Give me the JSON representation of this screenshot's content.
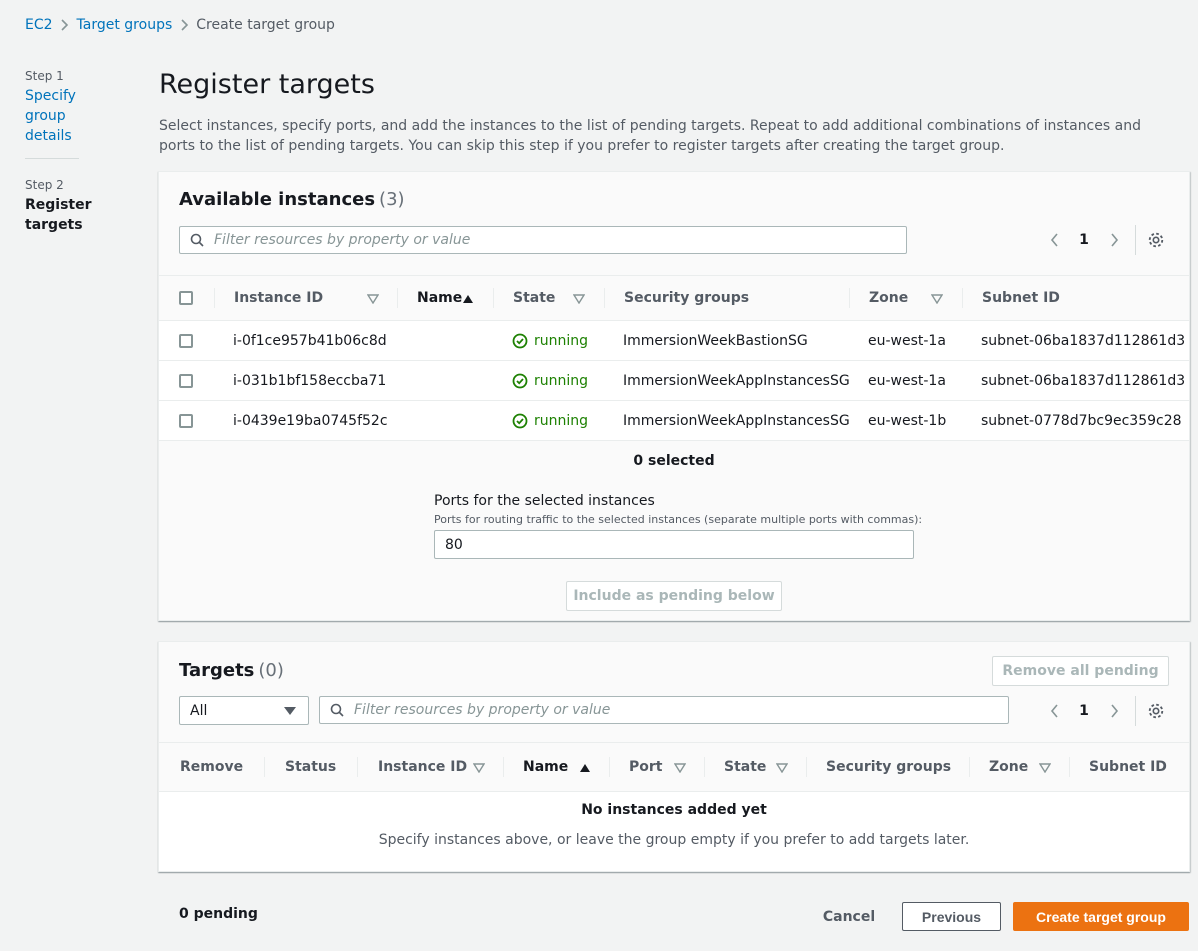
{
  "breadcrumb": {
    "items": [
      "EC2",
      "Target groups",
      "Create target group"
    ]
  },
  "steps": {
    "step1_num": "Step 1",
    "step1_label_lines": [
      "Specify",
      "group",
      "details"
    ],
    "step2_num": "Step 2",
    "step2_label_lines": [
      "Register",
      "targets"
    ]
  },
  "page": {
    "title": "Register targets",
    "description": "Select instances, specify ports, and add the instances to the list of pending targets. Repeat to add additional combinations of instances and ports to the list of pending targets. You can skip this step if you prefer to register targets after creating the target group."
  },
  "available": {
    "title": "Available instances",
    "count": "(3)",
    "filter_placeholder": "Filter resources by property or value",
    "page_number": "1",
    "columns": [
      "Instance ID",
      "Name",
      "State",
      "Security groups",
      "Zone",
      "Subnet ID"
    ],
    "rows": [
      {
        "instance_id": "i-0f1ce957b41b06c8d",
        "name": "",
        "state": "running",
        "security_group": "ImmersionWeekBastionSG",
        "zone": "eu-west-1a",
        "subnet": "subnet-06ba1837d112861d3"
      },
      {
        "instance_id": "i-031b1bf158eccba71",
        "name": "",
        "state": "running",
        "security_group": "ImmersionWeekAppInstancesSG",
        "zone": "eu-west-1a",
        "subnet": "subnet-06ba1837d112861d3"
      },
      {
        "instance_id": "i-0439e19ba0745f52c",
        "name": "",
        "state": "running",
        "security_group": "ImmersionWeekAppInstancesSG",
        "zone": "eu-west-1b",
        "subnet": "subnet-0778d7bc9ec359c28"
      }
    ],
    "selected_text": "0 selected",
    "ports_label": "Ports for the selected instances",
    "ports_description": "Ports for routing traffic to the selected instances (separate multiple ports with commas):",
    "ports_value": "80",
    "include_button": "Include as pending below"
  },
  "targets": {
    "title": "Targets",
    "count": "(0)",
    "remove_all_button": "Remove all pending",
    "filter_select_value": "All",
    "filter_placeholder": "Filter resources by property or value",
    "page_number": "1",
    "columns": [
      "Remove",
      "Status",
      "Instance ID",
      "Name",
      "Port",
      "State",
      "Security groups",
      "Zone",
      "Subnet ID"
    ],
    "empty_title": "No instances added yet",
    "empty_description": "Specify instances above, or leave the group empty if you prefer to add targets later."
  },
  "footer": {
    "pending_text": "0 pending",
    "cancel_button": "Cancel",
    "previous_button": "Previous",
    "create_button": "Create target group"
  },
  "colors": {
    "link": "#0073bb",
    "primary_button": "#ec7211",
    "running": "#1d8102"
  }
}
